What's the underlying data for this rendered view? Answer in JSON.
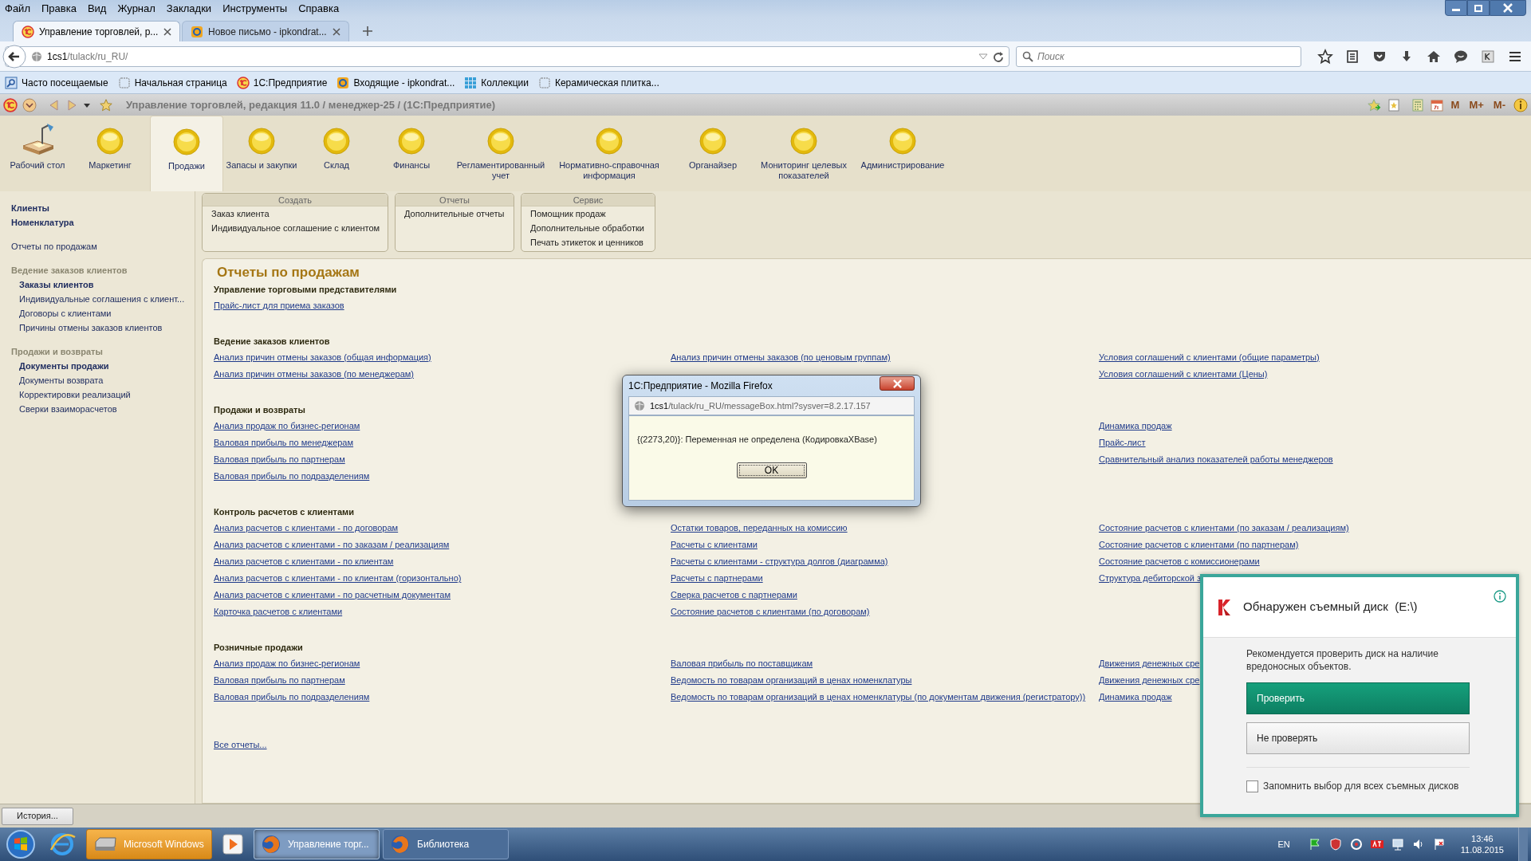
{
  "menu_bar": [
    "Файл",
    "Правка",
    "Вид",
    "Журнал",
    "Закладки",
    "Инструменты",
    "Справка"
  ],
  "tabs": [
    {
      "label": "Управление торговлей, р...",
      "selected": true,
      "kind": "onec"
    },
    {
      "label": "Новое письмо - ipkondrat...",
      "selected": false,
      "kind": "mail"
    }
  ],
  "address": {
    "value_host": "1cs1",
    "value_path": "/tulack/ru_RU/"
  },
  "search": {
    "placeholder": "Поиск"
  },
  "bookmarks": [
    {
      "label": "Часто посещаемые",
      "kind": "search"
    },
    {
      "label": "Начальная страница",
      "kind": "page"
    },
    {
      "label": "1С:Предприятие",
      "kind": "onec"
    },
    {
      "label": "Входящие - ipkondrat...",
      "kind": "mail"
    },
    {
      "label": "Коллекции",
      "kind": "grid"
    },
    {
      "label": "Керамическая плитка...",
      "kind": "page"
    }
  ],
  "app_title": "Управление торговлей, редакция 11.0 / менеджер-25 / (1С:Предприятие)",
  "memory_buttons": [
    "M",
    "M+",
    "M-"
  ],
  "sections": [
    {
      "label": "Рабочий стол",
      "selected": false,
      "kind": "desk"
    },
    {
      "label": "Маркетинг",
      "selected": false,
      "kind": "ball"
    },
    {
      "label": "Продажи",
      "selected": true,
      "kind": "ball"
    },
    {
      "label": "Запасы и закупки",
      "selected": false,
      "kind": "ball"
    },
    {
      "label": "Склад",
      "selected": false,
      "kind": "ball"
    },
    {
      "label": "Финансы",
      "selected": false,
      "kind": "ball"
    },
    {
      "label": "Регламентированный учет",
      "selected": false,
      "kind": "ball"
    },
    {
      "label": "Нормативно-справочная информация",
      "selected": false,
      "kind": "ball"
    },
    {
      "label": "Органайзер",
      "selected": false,
      "kind": "ball"
    },
    {
      "label": "Мониторинг целевых показателей",
      "selected": false,
      "kind": "ball"
    },
    {
      "label": "Администрирование",
      "selected": false,
      "kind": "ball"
    }
  ],
  "sidebar": {
    "items": [
      {
        "label": "Клиенты",
        "kind": "main"
      },
      {
        "label": "Номенклатура",
        "kind": "main"
      },
      {
        "label": "Отчеты по продажам",
        "kind": "plain"
      },
      {
        "label": "Ведение заказов клиентов",
        "kind": "group"
      },
      {
        "label": "Заказы клиентов",
        "kind": "sub-bold"
      },
      {
        "label": "Индивидуальные соглашения с клиент...",
        "kind": "sub"
      },
      {
        "label": "Договоры с клиентами",
        "kind": "sub"
      },
      {
        "label": "Причины отмены заказов клиентов",
        "kind": "sub"
      },
      {
        "label": "Продажи и возвраты",
        "kind": "group"
      },
      {
        "label": "Документы продажи",
        "kind": "sub-bold"
      },
      {
        "label": "Документы возврата",
        "kind": "sub"
      },
      {
        "label": "Корректировки реализаций",
        "kind": "sub"
      },
      {
        "label": "Сверки взаиморасчетов",
        "kind": "sub"
      }
    ]
  },
  "command_panels": [
    {
      "title": "Создать",
      "items": [
        "Заказ клиента",
        "Индивидуальное соглашение с клиентом"
      ]
    },
    {
      "title": "Отчеты",
      "items": [
        "Дополнительные отчеты"
      ]
    },
    {
      "title": "Сервис",
      "items": [
        "Помощник продаж",
        "Дополнительные обработки",
        "Печать этикеток и ценников"
      ]
    }
  ],
  "content": {
    "title": "Отчеты по продажам",
    "groups": [
      {
        "title": "Управление торговыми представителями",
        "columns": [
          [
            "Прайс-лист для приема заказов"
          ],
          [],
          []
        ]
      },
      {
        "title": "Ведение заказов клиентов",
        "columns": [
          [
            "Анализ причин отмены заказов (общая информация)",
            "Анализ причин отмены заказов (по менеджерам)"
          ],
          [
            "Анализ причин отмены заказов (по ценовым группам)"
          ],
          [
            "Условия соглашений с клиентами (общие параметры)",
            "Условия соглашений с клиентами (Цены)"
          ]
        ]
      },
      {
        "title": "Продажи и возвраты",
        "columns": [
          [
            "Анализ продаж по бизнес-регионам",
            "Валовая прибыль по менеджерам",
            "Валовая прибыль по партнерам",
            "Валовая прибыль по подразделениям"
          ],
          [],
          [
            "Динамика продаж",
            "Прайс-лист",
            "Сравнительный анализ показателей работы менеджеров"
          ]
        ]
      },
      {
        "title": "Контроль расчетов с клиентами",
        "columns": [
          [
            "Анализ расчетов с клиентами - по договорам",
            "Анализ расчетов с клиентами - по заказам / реализациям",
            "Анализ расчетов с клиентами - по клиентам",
            "Анализ расчетов с клиентами - по клиентам (горизонтально)",
            "Анализ расчетов с клиентами - по расчетным документам",
            "Карточка расчетов с клиентами"
          ],
          [
            "Остатки товаров, переданных на комиссию",
            "Расчеты с клиентами",
            "Расчеты с клиентами - структура долгов (диаграмма)",
            "Расчеты с партнерами",
            "Сверка расчетов с партнерами",
            "Состояние расчетов с клиентами (по договорам)"
          ],
          [
            "Состояние расчетов с клиентами (по заказам / реализациям)",
            "Состояние расчетов с клиентами (по партнерам)",
            "Состояние расчетов с комиссионерами",
            "Структура дебиторской з"
          ]
        ]
      },
      {
        "title": "Розничные продажи",
        "columns": [
          [
            "Анализ продаж по бизнес-регионам",
            "Валовая прибыль по партнерам",
            "Валовая прибыль по подразделениям"
          ],
          [
            "Валовая прибыль по поставщикам",
            "Ведомость по товарам организаций в ценах номенклатуры",
            "Ведомость по товарам организаций в ценах номенклатуры (по документам движения (регистратору))"
          ],
          [
            "Движения денежных сре",
            "Движения денежных сре",
            "Динамика продаж"
          ]
        ]
      }
    ],
    "all_reports": "Все отчеты..."
  },
  "history_button": "История...",
  "dialog": {
    "title": "1С:Предприятие - Mozilla Firefox",
    "url_host": "1cs1",
    "url_path": "/tulack/ru_RU/messageBox.html?sysver=8.2.17.157",
    "message": "{(2273,20)}: Переменная не определена (КодировкаXBase)",
    "ok": "OK"
  },
  "notification": {
    "title": "Обнаружен съемный диск  (E:\\)",
    "body": "Рекомендуется проверить диск на наличие вредоносных объектов.",
    "primary": "Проверить",
    "secondary": "Не проверять",
    "remember": {
      "label": "Запомнить выбор для всех съемных дисков",
      "checked": false
    }
  },
  "taskbar": {
    "items": [
      {
        "label": "Microsoft Windows",
        "kind": "drive",
        "selected": false,
        "highlighted": true
      },
      {
        "label": "Управление торг...",
        "kind": "firefox",
        "selected": true,
        "highlighted": false
      },
      {
        "label": "Библиотека",
        "kind": "firefox",
        "selected": false,
        "highlighted": false
      }
    ],
    "lang": "EN",
    "time": "13:46",
    "date": "11.08.2015"
  }
}
